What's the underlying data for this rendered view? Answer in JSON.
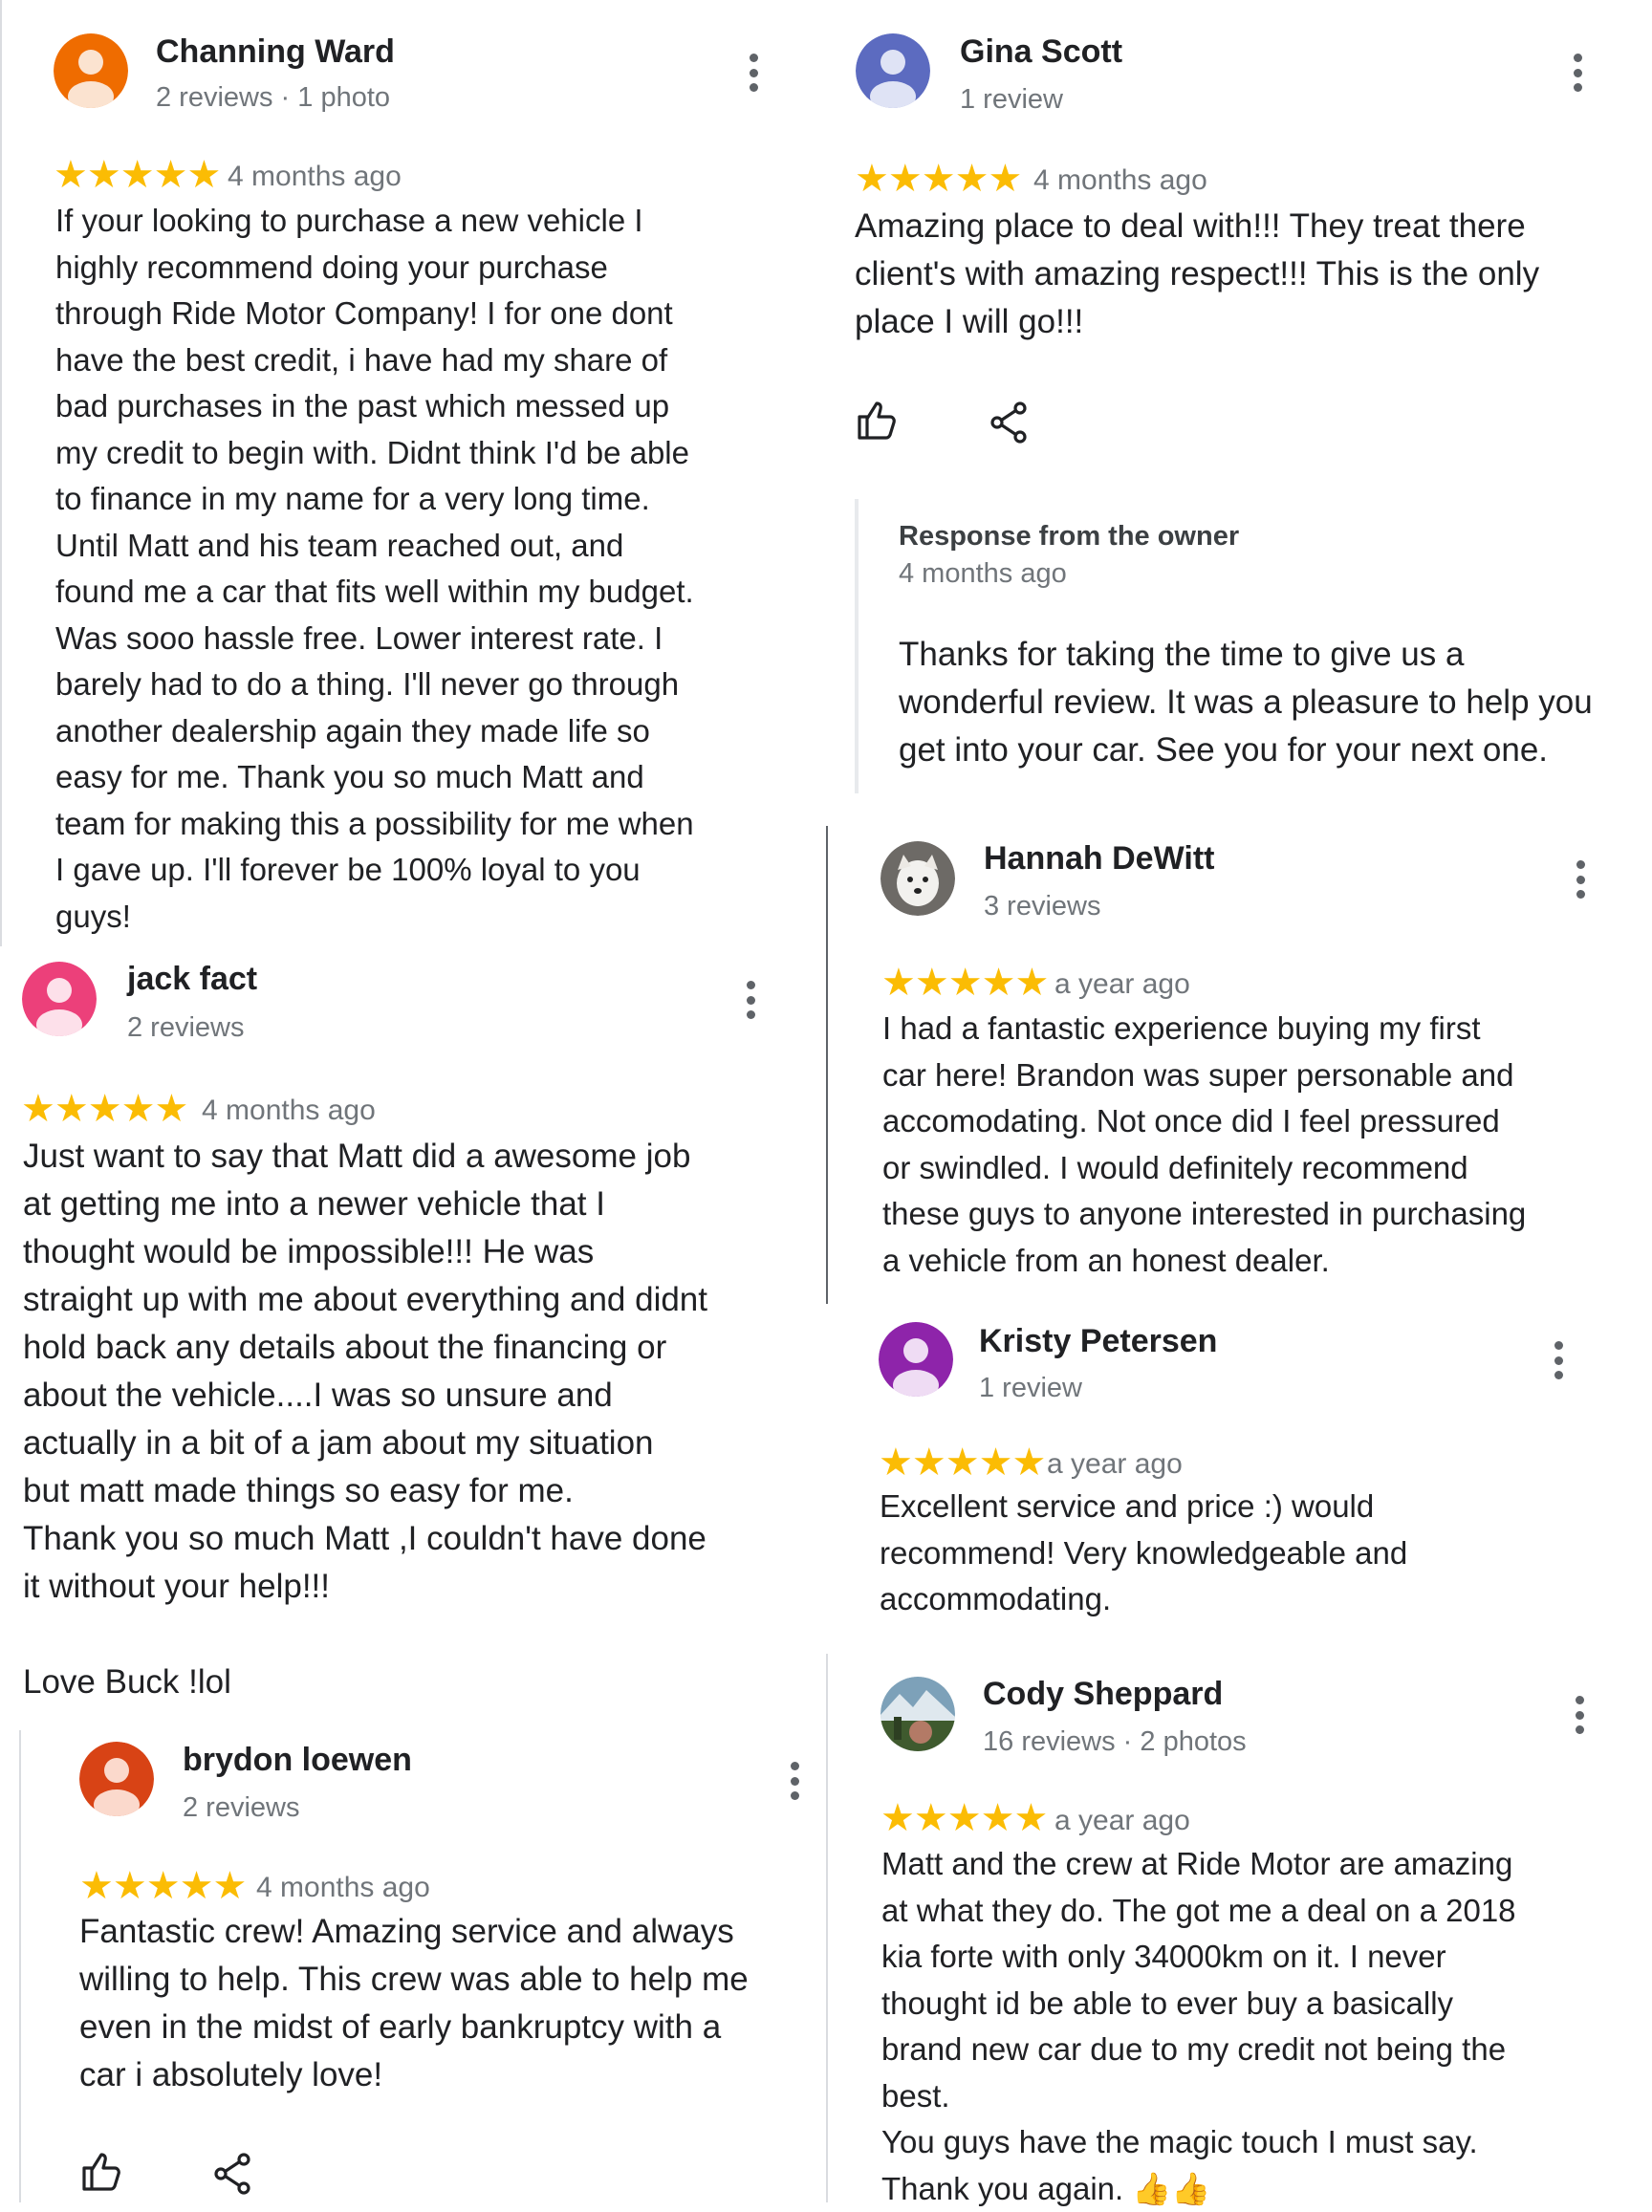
{
  "colors": {
    "star": "#fbbc04",
    "text": "#202124",
    "muted": "#70757a",
    "divider": "#dadce0"
  },
  "reviews": [
    {
      "name": "Channing Ward",
      "meta": "2 reviews · 1 photo",
      "avatar_color": "#ef6c00",
      "rating": 5,
      "stars": "★★★★★",
      "ago": "4 months ago",
      "text": "If your looking to purchase a new vehicle I\nhighly recommend doing your purchase\nthrough Ride Motor Company! I for one dont\nhave the best credit, i have had my share of\nbad purchases in the past which messed up\nmy credit to begin with. Didnt think I'd be able\nto finance in my name for a very long time.\nUntil Matt and his team reached out, and\nfound me a car that fits well within my budget.\nWas sooo hassle free. Lower interest rate. I\nbarely had to do a thing. I'll never go through\nanother dealership again they made life so\neasy for me. Thank you so much Matt and\nteam for making this a possibility for me when\nI gave up. I'll forever be 100% loyal to you\nguys!"
    },
    {
      "name": "jack fact",
      "meta": "2 reviews",
      "avatar_color": "#ec407a",
      "rating": 5,
      "stars": "★★★★★",
      "ago": "4 months ago",
      "text": "Just want to say that Matt did a awesome job\nat getting me into a newer vehicle that I\nthought would be impossible!!! He was\nstraight up with me about everything and didnt\nhold back any details about the financing or\nabout the vehicle....I was so unsure and\nactually in a bit of a jam about my situation\nbut matt made things so easy for me.\nThank you so much Matt ,I couldn't have done\nit without your help!!!\n\nLove Buck !lol"
    },
    {
      "name": "brydon loewen",
      "meta": "2 reviews",
      "avatar_color": "#d84315",
      "rating": 5,
      "stars": "★★★★★",
      "ago": "4 months ago",
      "text": "Fantastic crew! Amazing service and always\nwilling to help. This crew was able to help me\neven in the midst of early bankruptcy with a\ncar i absolutely love!"
    },
    {
      "name": "Gina Scott",
      "meta": "1 review",
      "avatar_color": "#5c6bc0",
      "rating": 5,
      "stars": "★★★★★",
      "ago": "4 months ago",
      "text": "Amazing place to deal with!!! They treat there\nclient's with amazing respect!!! This is the only\nplace I will go!!!",
      "owner_response": {
        "title": "Response from the owner",
        "ago": "4 months ago",
        "text": "Thanks for taking the time to give us a\nwonderful review. It was a pleasure to help you\nget into your car. See you for your next one."
      }
    },
    {
      "name": "Hannah DeWitt",
      "meta": "3 reviews",
      "rating": 5,
      "stars": "★★★★★",
      "ago": "a year ago",
      "text": "I had a fantastic experience buying my first\ncar here! Brandon was super personable and\naccomodating. Not once did I feel pressured\nor swindled. I would definitely recommend\nthese guys to anyone interested in purchasing\na vehicle from an honest dealer."
    },
    {
      "name": "Kristy Petersen",
      "meta": "1 review",
      "avatar_color": "#8e24aa",
      "rating": 5,
      "stars": "★★★★★",
      "ago": "a year ago",
      "text": "Excellent service and price :) would\nrecommend! Very knowledgeable and\naccommodating."
    },
    {
      "name": "Cody Sheppard",
      "meta": "16 reviews · 2 photos",
      "rating": 5,
      "stars": "★★★★★",
      "ago": "a year ago",
      "text": "Matt and the crew at Ride Motor are amazing\nat what they do. The got me a deal on a 2018\nkia forte with only 34000km on it. I never\nthought id be able to ever buy a basically\nbrand new car due to my credit not being the\nbest.\nYou guys have the magic touch I must say.\nThank you again. 👍👍"
    }
  ]
}
